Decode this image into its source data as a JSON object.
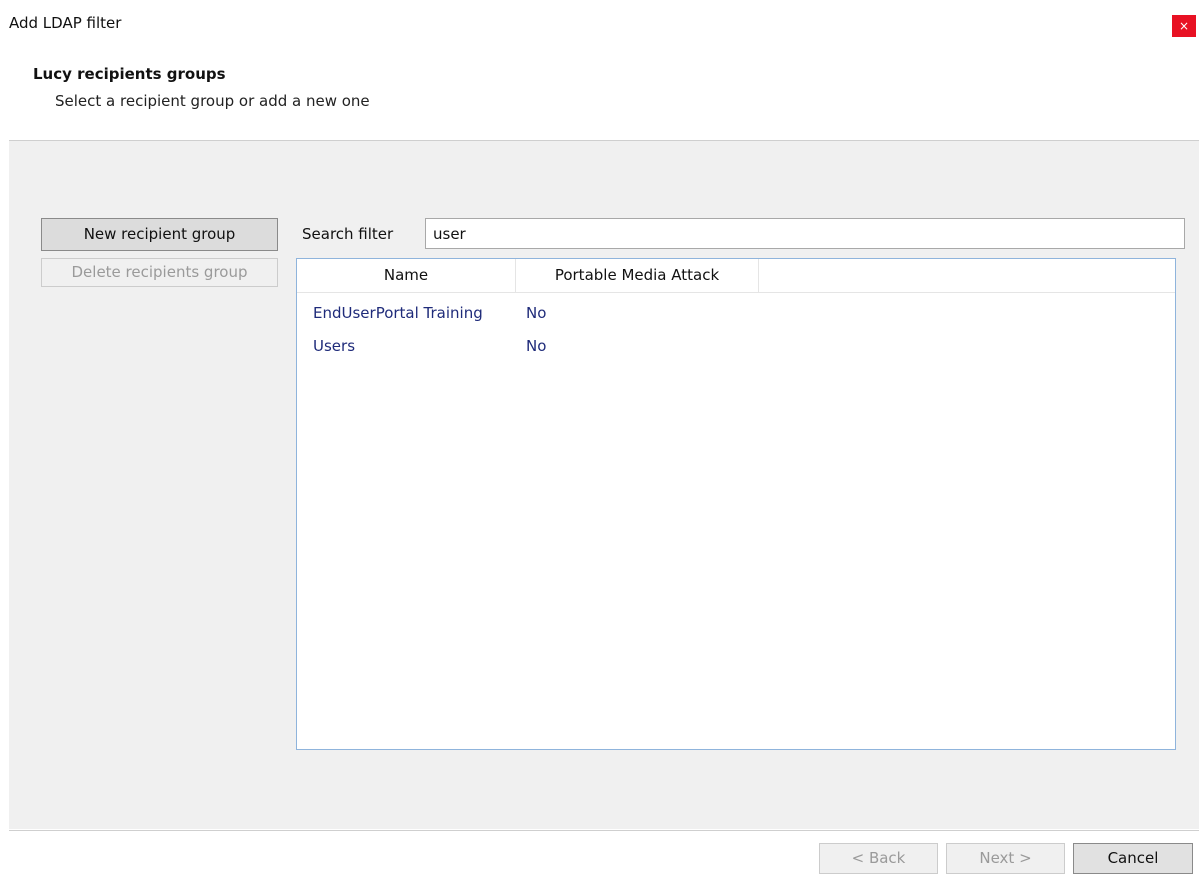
{
  "window": {
    "title": "Add LDAP filter",
    "close_glyph": "×"
  },
  "header": {
    "title": "Lucy recipients groups",
    "subtitle": "Select a recipient group or add a new one"
  },
  "actions": {
    "new_group_label": "New recipient group",
    "delete_group_label": "Delete recipients group"
  },
  "search": {
    "label": "Search filter",
    "value": "user"
  },
  "table": {
    "columns": [
      "Name",
      "Portable Media Attack"
    ],
    "rows": [
      {
        "name": "EndUserPortal Training",
        "portable_media_attack": "No"
      },
      {
        "name": "Users",
        "portable_media_attack": "No"
      }
    ]
  },
  "footer": {
    "back_label": "< Back",
    "next_label": "Next >",
    "cancel_label": "Cancel"
  },
  "colors": {
    "close_button": "#e81123",
    "row_text": "#1f2b7a",
    "list_border": "#8fb4dc"
  },
  "icons": {
    "close": "close-icon"
  }
}
